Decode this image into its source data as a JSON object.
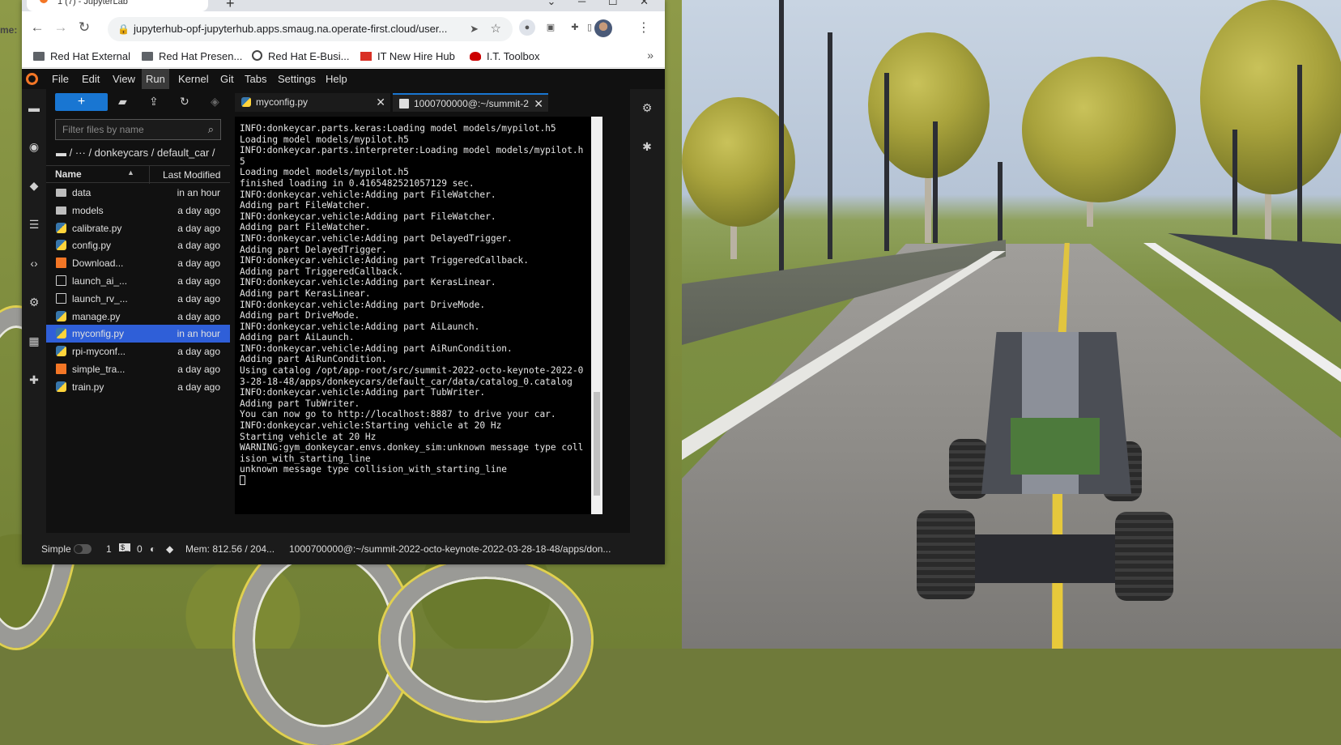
{
  "browser": {
    "tab_title": "1 (7) - JupyterLab",
    "tab_close": "✕",
    "new_tab": "+",
    "window_controls": "⌄ ─ ☐ ✕",
    "url": "jupyterhub-opf-jupyterhub.apps.smaug.na.operate-first.cloud/user...",
    "bookmarks": [
      {
        "label": "Red Hat External",
        "icon": "folder-icon"
      },
      {
        "label": "Red Hat Presen...",
        "icon": "folder-icon"
      },
      {
        "label": "Red Hat E-Busi...",
        "icon": "globe-icon"
      },
      {
        "label": "IT New Hire Hub",
        "icon": "now-icon"
      },
      {
        "label": "I.T. Toolbox",
        "icon": "redhat-icon"
      }
    ],
    "bookmarks_more": "»"
  },
  "jupyterlab": {
    "menus": [
      "File",
      "Edit",
      "View",
      "Run",
      "Kernel",
      "Git",
      "Tabs",
      "Settings",
      "Help"
    ],
    "active_menu": "Run",
    "filebrowser": {
      "new_button": "+",
      "filter_placeholder": "Filter files by name",
      "breadcrumb": "/   ···   /  donkeycars / default_car /",
      "col_name": "Name",
      "col_modified": "Last Modified",
      "files": [
        {
          "name": "data",
          "modified": "in an hour",
          "type": "folder"
        },
        {
          "name": "models",
          "modified": "a day ago",
          "type": "folder"
        },
        {
          "name": "calibrate.py",
          "modified": "a day ago",
          "type": "py"
        },
        {
          "name": "config.py",
          "modified": "a day ago",
          "type": "py"
        },
        {
          "name": "Download...",
          "modified": "a day ago",
          "type": "nb"
        },
        {
          "name": "launch_ai_...",
          "modified": "a day ago",
          "type": "txt"
        },
        {
          "name": "launch_rv_...",
          "modified": "a day ago",
          "type": "txt"
        },
        {
          "name": "manage.py",
          "modified": "a day ago",
          "type": "py"
        },
        {
          "name": "myconfig.py",
          "modified": "in an hour",
          "type": "py",
          "selected": true
        },
        {
          "name": "rpi-myconf...",
          "modified": "a day ago",
          "type": "py"
        },
        {
          "name": "simple_tra...",
          "modified": "a day ago",
          "type": "nb"
        },
        {
          "name": "train.py",
          "modified": "a day ago",
          "type": "py"
        }
      ]
    },
    "tabs": [
      {
        "label": "myconfig.py",
        "icon": "python-icon"
      },
      {
        "label": "1000700000@:~/summit-2",
        "icon": "terminal-icon"
      }
    ],
    "terminal_output": "INFO:donkeycar.parts.keras:Loading model models/mypilot.h5\nLoading model models/mypilot.h5\nINFO:donkeycar.parts.interpreter:Loading model models/mypilot.h5\nLoading model models/mypilot.h5\nfinished loading in 0.4165482521057129 sec.\nINFO:donkeycar.vehicle:Adding part FileWatcher.\nAdding part FileWatcher.\nINFO:donkeycar.vehicle:Adding part FileWatcher.\nAdding part FileWatcher.\nINFO:donkeycar.vehicle:Adding part DelayedTrigger.\nAdding part DelayedTrigger.\nINFO:donkeycar.vehicle:Adding part TriggeredCallback.\nAdding part TriggeredCallback.\nINFO:donkeycar.vehicle:Adding part KerasLinear.\nAdding part KerasLinear.\nINFO:donkeycar.vehicle:Adding part DriveMode.\nAdding part DriveMode.\nINFO:donkeycar.vehicle:Adding part AiLaunch.\nAdding part AiLaunch.\nINFO:donkeycar.vehicle:Adding part AiRunCondition.\nAdding part AiRunCondition.\nUsing catalog /opt/app-root/src/summit-2022-octo-keynote-2022-03-28-18-48/apps/donkeycars/default_car/data/catalog_0.catalog\nINFO:donkeycar.vehicle:Adding part TubWriter.\nAdding part TubWriter.\nYou can now go to http://localhost:8887 to drive your car.\nINFO:donkeycar.vehicle:Starting vehicle at 20 Hz\nStarting vehicle at 20 Hz\nWARNING:gym_donkeycar.envs.donkey_sim:unknown message type collision_with_starting_line\nunknown message type collision_with_starting_line\n",
    "status": {
      "mode": "Simple",
      "kernels": "1",
      "terminals": "0",
      "memory": "Mem: 812.56 / 204...",
      "path": "1000700000@:~/summit-2022-octo-keynote-2022-03-28-18-48/apps/don..."
    }
  },
  "edge_label": "me:"
}
